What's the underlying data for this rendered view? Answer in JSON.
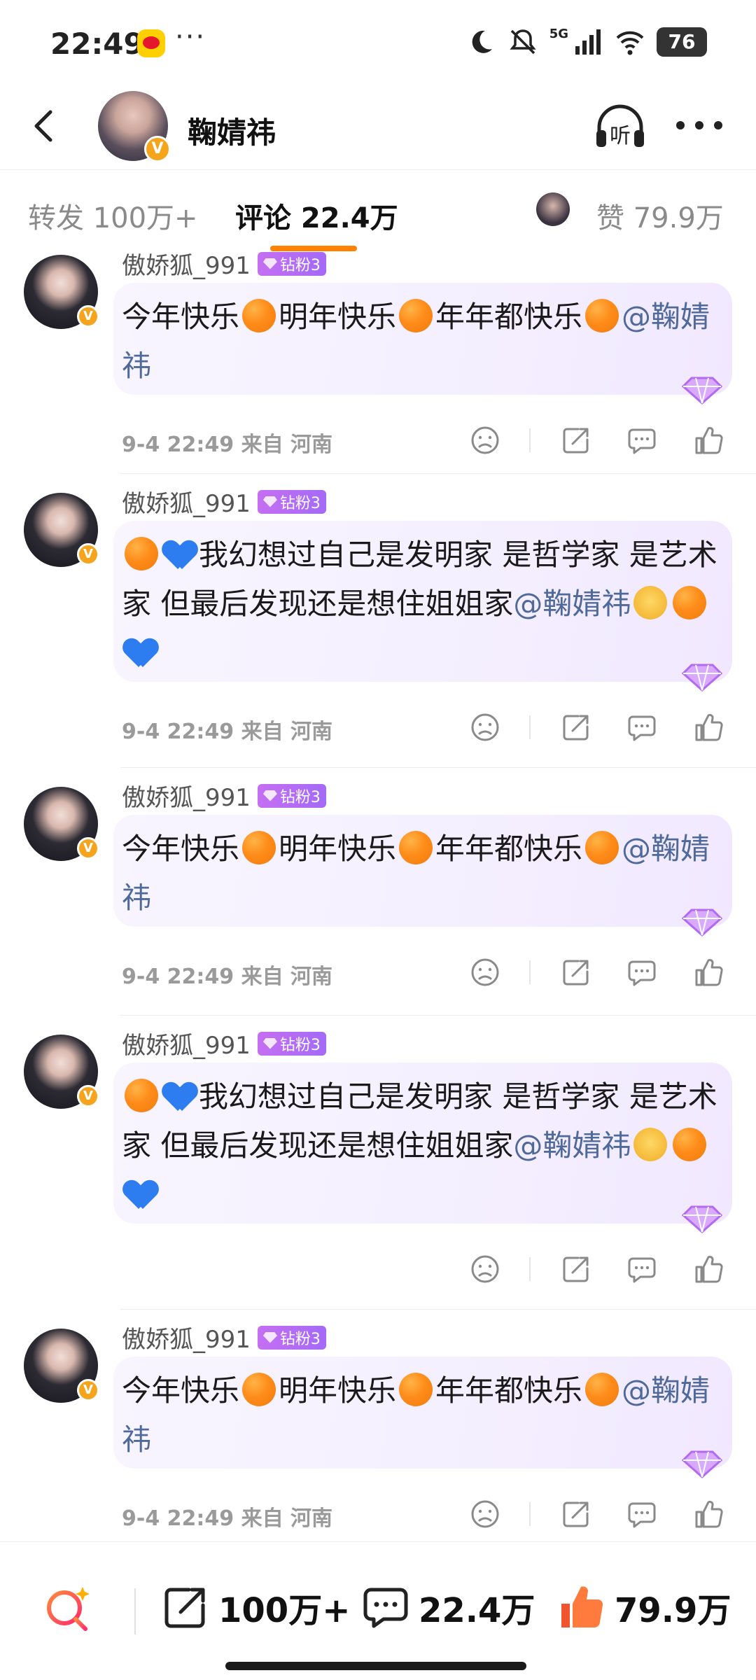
{
  "status_bar": {
    "time": "22:49",
    "more": "···",
    "network": "5G",
    "battery": "76"
  },
  "header": {
    "title": "鞠婧祎",
    "listen_label": "听"
  },
  "tabs": {
    "repost": "转发 100万+",
    "comment": "评论 22.4万",
    "like": "赞 79.9万"
  },
  "comments": [
    {
      "user": "傲娇狐_991",
      "fan_badge": "钻粉3",
      "segments": [
        {
          "t": "今年快乐"
        },
        {
          "e": "orange"
        },
        {
          "t": "明年快乐"
        },
        {
          "e": "orange"
        },
        {
          "t": "年年都快乐"
        },
        {
          "e": "orange"
        },
        {
          "m": "@鞠婧祎"
        }
      ],
      "meta": "9-4 22:49  来自 河南"
    },
    {
      "user": "傲娇狐_991",
      "fan_badge": "钻粉3",
      "segments": [
        {
          "e": "orange"
        },
        {
          "e": "heart"
        },
        {
          "t": "我幻想过自己是发明家 是哲学家 是艺术家 但最后发现还是想住姐姐家"
        },
        {
          "m": "@鞠婧祎"
        },
        {
          "e": "plead"
        },
        {
          "e": "orange"
        },
        {
          "e": "heart"
        }
      ],
      "meta": "9-4 22:49  来自 河南"
    },
    {
      "user": "傲娇狐_991",
      "fan_badge": "钻粉3",
      "segments": [
        {
          "t": "今年快乐"
        },
        {
          "e": "orange"
        },
        {
          "t": "明年快乐"
        },
        {
          "e": "orange"
        },
        {
          "t": "年年都快乐"
        },
        {
          "e": "orange"
        },
        {
          "m": "@鞠婧祎"
        }
      ],
      "meta": "9-4 22:49  来自 河南"
    },
    {
      "user": "傲娇狐_991",
      "fan_badge": "钻粉3",
      "segments": [
        {
          "e": "orange"
        },
        {
          "e": "heart"
        },
        {
          "t": "我幻想过自己是发明家 是哲学家 是艺术家 但最后发现还是想住姐姐家"
        },
        {
          "m": "@鞠婧祎"
        },
        {
          "e": "plead"
        },
        {
          "e": "orange"
        },
        {
          "e": "heart"
        }
      ],
      "meta": ""
    },
    {
      "user": "傲娇狐_991",
      "fan_badge": "钻粉3",
      "segments": [
        {
          "t": "今年快乐"
        },
        {
          "e": "orange"
        },
        {
          "t": "明年快乐"
        },
        {
          "e": "orange"
        },
        {
          "t": "年年都快乐"
        },
        {
          "e": "orange"
        },
        {
          "m": "@鞠婧祎"
        }
      ],
      "meta": "9-4 22:49  来自 河南"
    }
  ],
  "bottom_bar": {
    "repost_count": "100万+",
    "comment_count": "22.4万",
    "like_count": "79.9万"
  },
  "colors": {
    "accent": "#ff8200",
    "mention": "#4f6a9a",
    "fan_badge": "#b66cf5",
    "verified": "#f7a41d",
    "like_thumb": "#f0552d"
  },
  "icons": [
    "back-icon",
    "listen-icon",
    "more-icon",
    "dislike-icon",
    "share-icon",
    "reply-icon",
    "like-icon",
    "search-icon",
    "repost-icon",
    "comment-icon",
    "thumb-icon"
  ]
}
